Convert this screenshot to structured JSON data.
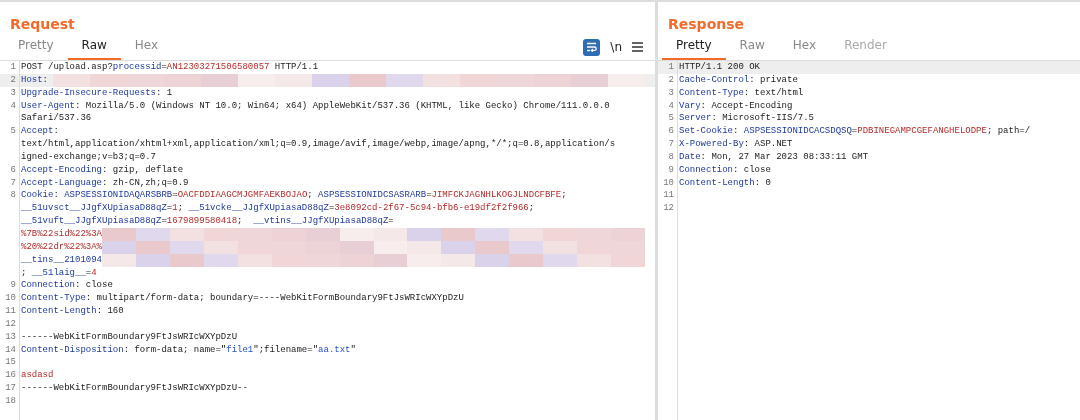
{
  "panels": [
    {
      "title": "Request",
      "tabs": [
        {
          "label": "Pretty",
          "selected": false,
          "disabled": false
        },
        {
          "label": "Raw",
          "selected": true,
          "disabled": false
        },
        {
          "label": "Hex",
          "selected": false,
          "disabled": false
        }
      ],
      "tools": [
        {
          "kind": "wrap",
          "on": true
        },
        {
          "kind": "text",
          "label": "\\n"
        },
        {
          "kind": "menu"
        }
      ],
      "lines": [
        {
          "number": "1",
          "highlighted": false,
          "rows": [
            {
              "segments": [
                {
                  "kind": "plain",
                  "text": "POST /upload.asp?"
                },
                {
                  "kind": "key",
                  "text": "processid"
                },
                {
                  "kind": "plain",
                  "text": "="
                },
                {
                  "kind": "value",
                  "text": "AN12303271506580057"
                },
                {
                  "kind": "plain",
                  "text": " HTTP/1.1"
                }
              ]
            }
          ]
        },
        {
          "number": "2",
          "highlighted": true,
          "rows": [
            {
              "segments": [
                {
                  "kind": "key",
                  "text": "Host"
                },
                {
                  "kind": "plain",
                  "text": ": "
                },
                {
                  "kind": "redacted"
                }
              ]
            }
          ]
        },
        {
          "number": "3",
          "highlighted": false,
          "rows": [
            {
              "segments": [
                {
                  "kind": "key",
                  "text": "Upgrade-Insecure-Requests"
                },
                {
                  "kind": "plain",
                  "text": ": 1"
                }
              ]
            }
          ]
        },
        {
          "number": "4",
          "highlighted": false,
          "rows": [
            {
              "segments": [
                {
                  "kind": "key",
                  "text": "User-Agent"
                },
                {
                  "kind": "plain",
                  "text": ": Mozilla/5.0 (Windows NT 10.0; Win64; x64) AppleWebKit/537.36 (KHTML, like Gecko) Chrome/111.0.0.0"
                }
              ]
            },
            {
              "segments": [
                {
                  "kind": "plain",
                  "text": "Safari/537.36"
                }
              ]
            }
          ]
        },
        {
          "number": "5",
          "highlighted": false,
          "rows": [
            {
              "segments": [
                {
                  "kind": "key",
                  "text": "Accept"
                },
                {
                  "kind": "plain",
                  "text": ":"
                }
              ]
            },
            {
              "segments": [
                {
                  "kind": "plain",
                  "text": "text/html,application/xhtml+xml,application/xml;q=0.9,image/avif,image/webp,image/apng,*/*;q=0.8,application/s"
                }
              ]
            },
            {
              "segments": [
                {
                  "kind": "plain",
                  "text": "igned-exchange;v=b3;q=0.7"
                }
              ]
            }
          ]
        },
        {
          "number": "6",
          "highlighted": false,
          "rows": [
            {
              "segments": [
                {
                  "kind": "key",
                  "text": "Accept-Encoding"
                },
                {
                  "kind": "plain",
                  "text": ": gzip, deflate"
                }
              ]
            }
          ]
        },
        {
          "number": "7",
          "highlighted": false,
          "rows": [
            {
              "segments": [
                {
                  "kind": "key",
                  "text": "Accept-Language"
                },
                {
                  "kind": "plain",
                  "text": ": zh-CN,zh;q=0.9"
                }
              ]
            }
          ]
        },
        {
          "number": "8",
          "highlighted": false,
          "rows": [
            {
              "segments": [
                {
                  "kind": "key",
                  "text": "Cookie"
                },
                {
                  "kind": "plain",
                  "text": ": "
                },
                {
                  "kind": "key",
                  "text": "ASPSESSIONIDAQARSBRB"
                },
                {
                  "kind": "plain",
                  "text": "="
                },
                {
                  "kind": "value",
                  "text": "OACFDDIAAGCMJGMFAEKBOJAO"
                },
                {
                  "kind": "plain",
                  "text": "; "
                },
                {
                  "kind": "key",
                  "text": "ASPSESSIONIDCSASRARB"
                },
                {
                  "kind": "plain",
                  "text": "="
                },
                {
                  "kind": "value",
                  "text": "JIMFCKJAGNHLKOGJLNDCFBFE"
                },
                {
                  "kind": "plain",
                  "text": ";"
                }
              ]
            },
            {
              "segments": [
                {
                  "kind": "key",
                  "text": "__51uvsct__JJgfXUpiasaD88qZ"
                },
                {
                  "kind": "plain",
                  "text": "="
                },
                {
                  "kind": "value",
                  "text": "1"
                },
                {
                  "kind": "plain",
                  "text": "; "
                },
                {
                  "kind": "key",
                  "text": "__51vcke__JJgfXUpiasaD88qZ"
                },
                {
                  "kind": "plain",
                  "text": "="
                },
                {
                  "kind": "value",
                  "text": "3e8092cd-2f67-5c94-bfb6-e19df2f2f966"
                },
                {
                  "kind": "plain",
                  "text": ";"
                }
              ]
            },
            {
              "segments": [
                {
                  "kind": "key",
                  "text": "__51vuft__JJgfXUpiasaD88qZ"
                },
                {
                  "kind": "plain",
                  "text": "="
                },
                {
                  "kind": "value",
                  "text": "1679899580418"
                },
                {
                  "kind": "plain",
                  "text": ";  "
                },
                {
                  "kind": "key",
                  "text": "__vtins__JJgfXUpiasaD88qZ"
                },
                {
                  "kind": "plain",
                  "text": "="
                }
              ]
            },
            {
              "segments": [
                {
                  "kind": "value",
                  "text": "%7B%22sid%22%3A"
                },
                {
                  "kind": "redacted"
                }
              ]
            },
            {
              "segments": [
                {
                  "kind": "value",
                  "text": "%20%22dr%22%3A%"
                },
                {
                  "kind": "redacted"
                }
              ]
            },
            {
              "segments": [
                {
                  "kind": "key",
                  "text": "__tins__2101094"
                },
                {
                  "kind": "redacted"
                }
              ]
            },
            {
              "segments": [
                {
                  "kind": "plain",
                  "text": "; "
                },
                {
                  "kind": "key",
                  "text": "__51laig__"
                },
                {
                  "kind": "plain",
                  "text": "="
                },
                {
                  "kind": "value",
                  "text": "4"
                }
              ]
            }
          ]
        },
        {
          "number": "9",
          "highlighted": false,
          "rows": [
            {
              "segments": [
                {
                  "kind": "key",
                  "text": "Connection"
                },
                {
                  "kind": "plain",
                  "text": ": close"
                }
              ]
            }
          ]
        },
        {
          "number": "10",
          "highlighted": false,
          "rows": [
            {
              "segments": [
                {
                  "kind": "key",
                  "text": "Content-Type"
                },
                {
                  "kind": "plain",
                  "text": ": multipart/form-data; boundary=----WebKitFormBoundary9FtJsWRIcWXYpDzU"
                }
              ]
            }
          ]
        },
        {
          "number": "11",
          "highlighted": false,
          "rows": [
            {
              "segments": [
                {
                  "kind": "key",
                  "text": "Content-Length"
                },
                {
                  "kind": "plain",
                  "text": ": 160"
                }
              ]
            }
          ]
        },
        {
          "number": "12",
          "highlighted": false,
          "rows": [
            {
              "segments": []
            }
          ]
        },
        {
          "number": "13",
          "highlighted": false,
          "rows": [
            {
              "segments": [
                {
                  "kind": "plain",
                  "text": "------WebKitFormBoundary9FtJsWRIcWXYpDzU"
                }
              ]
            }
          ]
        },
        {
          "number": "14",
          "highlighted": false,
          "rows": [
            {
              "segments": [
                {
                  "kind": "key",
                  "text": "Content-Disposition"
                },
                {
                  "kind": "plain",
                  "text": ": form-data; name=\""
                },
                {
                  "kind": "string",
                  "text": "file1"
                },
                {
                  "kind": "plain",
                  "text": "\";filename=\""
                },
                {
                  "kind": "string",
                  "text": "aa.txt"
                },
                {
                  "kind": "plain",
                  "text": "\""
                }
              ]
            }
          ]
        },
        {
          "number": "15",
          "highlighted": false,
          "rows": [
            {
              "segments": []
            }
          ]
        },
        {
          "number": "16",
          "highlighted": false,
          "rows": [
            {
              "segments": [
                {
                  "kind": "value",
                  "text": "asdasd"
                }
              ]
            }
          ]
        },
        {
          "number": "17",
          "highlighted": false,
          "rows": [
            {
              "segments": [
                {
                  "kind": "plain",
                  "text": "------WebKitFormBoundary9FtJsWRIcWXYpDzU--"
                }
              ]
            }
          ]
        },
        {
          "number": "18",
          "highlighted": false,
          "rows": [
            {
              "segments": []
            }
          ]
        }
      ]
    },
    {
      "title": "Response",
      "tabs": [
        {
          "label": "Pretty",
          "selected": true,
          "disabled": false
        },
        {
          "label": "Raw",
          "selected": false,
          "disabled": false
        },
        {
          "label": "Hex",
          "selected": false,
          "disabled": false
        },
        {
          "label": "Render",
          "selected": false,
          "disabled": true
        }
      ],
      "lines": [
        {
          "number": "1",
          "highlighted": true,
          "rows": [
            {
              "segments": [
                {
                  "kind": "plain",
                  "text": "HTTP/1.1 200 OK"
                }
              ]
            }
          ]
        },
        {
          "number": "2",
          "highlighted": false,
          "rows": [
            {
              "segments": [
                {
                  "kind": "key",
                  "text": "Cache-Control"
                },
                {
                  "kind": "plain",
                  "text": ": private"
                }
              ]
            }
          ]
        },
        {
          "number": "3",
          "highlighted": false,
          "rows": [
            {
              "segments": [
                {
                  "kind": "key",
                  "text": "Content-Type"
                },
                {
                  "kind": "plain",
                  "text": ": text/html"
                }
              ]
            }
          ]
        },
        {
          "number": "4",
          "highlighted": false,
          "rows": [
            {
              "segments": [
                {
                  "kind": "key",
                  "text": "Vary"
                },
                {
                  "kind": "plain",
                  "text": ": Accept-Encoding"
                }
              ]
            }
          ]
        },
        {
          "number": "5",
          "highlighted": false,
          "rows": [
            {
              "segments": [
                {
                  "kind": "key",
                  "text": "Server"
                },
                {
                  "kind": "plain",
                  "text": ": Microsoft-IIS/7.5"
                }
              ]
            }
          ]
        },
        {
          "number": "6",
          "highlighted": false,
          "rows": [
            {
              "segments": [
                {
                  "kind": "key",
                  "text": "Set-Cookie"
                },
                {
                  "kind": "plain",
                  "text": ": "
                },
                {
                  "kind": "key",
                  "text": "ASPSESSIONIDCACSDQSQ"
                },
                {
                  "kind": "plain",
                  "text": "="
                },
                {
                  "kind": "value",
                  "text": "PDBINEGAMPCGEFANGHELODPE"
                },
                {
                  "kind": "plain",
                  "text": "; path=/"
                }
              ]
            }
          ]
        },
        {
          "number": "7",
          "highlighted": false,
          "rows": [
            {
              "segments": [
                {
                  "kind": "key",
                  "text": "X-Powered-By"
                },
                {
                  "kind": "plain",
                  "text": ": ASP.NET"
                }
              ]
            }
          ]
        },
        {
          "number": "8",
          "highlighted": false,
          "rows": [
            {
              "segments": [
                {
                  "kind": "key",
                  "text": "Date"
                },
                {
                  "kind": "plain",
                  "text": ": Mon, 27 Mar 2023 08:33:11 GMT"
                }
              ]
            }
          ]
        },
        {
          "number": "9",
          "highlighted": false,
          "rows": [
            {
              "segments": [
                {
                  "kind": "key",
                  "text": "Connection"
                },
                {
                  "kind": "plain",
                  "text": ": close"
                }
              ]
            }
          ]
        },
        {
          "number": "10",
          "highlighted": false,
          "rows": [
            {
              "segments": [
                {
                  "kind": "key",
                  "text": "Content-Length"
                },
                {
                  "kind": "plain",
                  "text": ": 0"
                }
              ]
            }
          ]
        },
        {
          "number": "11",
          "highlighted": false,
          "rows": [
            {
              "segments": []
            }
          ]
        },
        {
          "number": "12",
          "highlighted": false,
          "rows": [
            {
              "segments": []
            }
          ]
        }
      ]
    }
  ]
}
